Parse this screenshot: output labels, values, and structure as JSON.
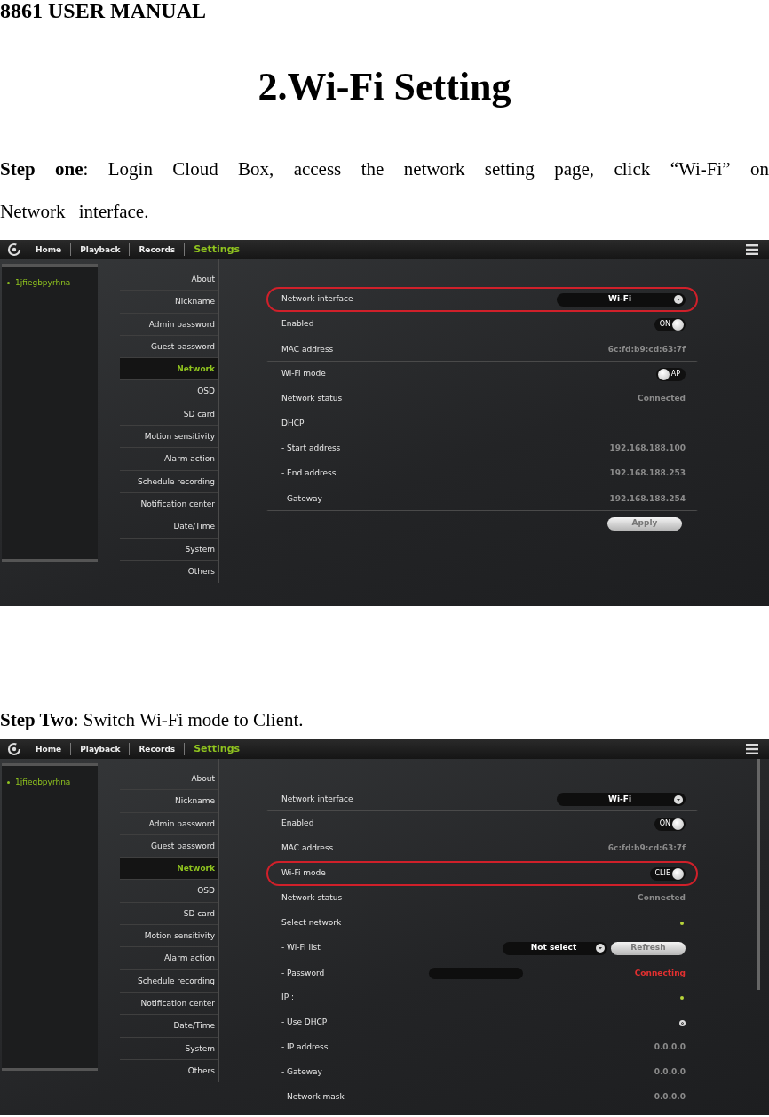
{
  "header": "8861 USER MANUAL",
  "title": "2.Wi-Fi Setting",
  "sections": [
    {
      "instruction": "**Step one**: Login Cloud Box, access the network setting page, click “Wi-Fi” on Network interface.",
      "screenshot": {
        "nav_tabs": [
          {
            "label": "Home",
            "selected": false
          },
          {
            "label": "Playback",
            "selected": false
          },
          {
            "label": "Records",
            "selected": false
          },
          {
            "label": "Settings",
            "selected": true
          }
        ],
        "devices": [
          "1jfiegbpyrhna"
        ],
        "menu": [
          {
            "label": "About",
            "selected": false
          },
          {
            "label": "Nickname",
            "selected": false
          },
          {
            "label": "Admin password",
            "selected": false
          },
          {
            "label": "Guest password",
            "selected": false
          },
          {
            "label": "Network",
            "selected": true
          },
          {
            "label": "OSD",
            "selected": false
          },
          {
            "label": "SD card",
            "selected": false
          },
          {
            "label": "Motion sensitivity",
            "selected": false
          },
          {
            "label": "Alarm action",
            "selected": false
          },
          {
            "label": "Schedule recording",
            "selected": false
          },
          {
            "label": "Notification center",
            "selected": false
          },
          {
            "label": "Date/Time",
            "selected": false
          },
          {
            "label": "System",
            "selected": false
          },
          {
            "label": "Others",
            "selected": false
          }
        ],
        "rows": [
          {
            "kind": "dropdown",
            "label": "Network interface",
            "value": "Wi-Fi",
            "circled": true,
            "divider": true
          },
          {
            "kind": "toggle",
            "label": "Enabled",
            "value": "ON",
            "on": true,
            "circled": false,
            "divider": false
          },
          {
            "kind": "text",
            "label": "MAC address",
            "value": "6c:fd:b9:cd:63:7f",
            "circled": false,
            "divider": true
          },
          {
            "kind": "toggle",
            "label": "Wi-Fi mode",
            "value": "AP",
            "on": false,
            "circled": false,
            "divider": false
          },
          {
            "kind": "text",
            "label": "Network status",
            "value": "Connected",
            "circled": false,
            "divider": false
          },
          {
            "kind": "heading",
            "label": "DHCP",
            "circled": false,
            "divider": false
          },
          {
            "kind": "text",
            "label": "- Start address",
            "value": "192.168.188.100",
            "circled": false,
            "divider": false
          },
          {
            "kind": "text",
            "label": "- End address",
            "value": "192.168.188.253",
            "circled": false,
            "divider": false
          },
          {
            "kind": "text",
            "label": "- Gateway",
            "value": "192.168.188.254",
            "circled": false,
            "divider": true
          },
          {
            "kind": "button",
            "label": "Apply",
            "circled": false,
            "divider": false
          }
        ],
        "scrollbar": false
      }
    },
    {
      "instruction": "**Step Two**: Switch Wi-Fi mode to Client.",
      "screenshot": {
        "nav_tabs": [
          {
            "label": "Home",
            "selected": false
          },
          {
            "label": "Playback",
            "selected": false
          },
          {
            "label": "Records",
            "selected": false
          },
          {
            "label": "Settings",
            "selected": true
          }
        ],
        "devices": [
          "1jfiegbpyrhna"
        ],
        "menu": [
          {
            "label": "About",
            "selected": false
          },
          {
            "label": "Nickname",
            "selected": false
          },
          {
            "label": "Admin password",
            "selected": false
          },
          {
            "label": "Guest password",
            "selected": false
          },
          {
            "label": "Network",
            "selected": true
          },
          {
            "label": "OSD",
            "selected": false
          },
          {
            "label": "SD card",
            "selected": false
          },
          {
            "label": "Motion sensitivity",
            "selected": false
          },
          {
            "label": "Alarm action",
            "selected": false
          },
          {
            "label": "Schedule recording",
            "selected": false
          },
          {
            "label": "Notification center",
            "selected": false
          },
          {
            "label": "Date/Time",
            "selected": false
          },
          {
            "label": "System",
            "selected": false
          },
          {
            "label": "Others",
            "selected": false
          }
        ],
        "rows": [
          {
            "kind": "dropdown",
            "label": "Network interface",
            "value": "Wi-Fi",
            "circled": false,
            "divider": true
          },
          {
            "kind": "toggle",
            "label": "Enabled",
            "value": "ON",
            "on": true,
            "circled": false,
            "divider": false
          },
          {
            "kind": "text",
            "label": "MAC address",
            "value": "6c:fd:b9:cd:63:7f",
            "circled": false,
            "divider": false
          },
          {
            "kind": "toggle",
            "label": "Wi-Fi mode",
            "value": "CLIE",
            "on": true,
            "circled": true,
            "divider": false
          },
          {
            "kind": "text",
            "label": "Network status",
            "value": "Connected",
            "circled": false,
            "divider": false
          },
          {
            "kind": "indicator",
            "label": "Select network :",
            "circled": false,
            "divider": false
          },
          {
            "kind": "select_refresh",
            "label": "- Wi-Fi list",
            "value": "Not select",
            "button": "Refresh",
            "circled": false,
            "divider": false
          },
          {
            "kind": "password",
            "label": "- Password",
            "status": "Connecting",
            "circled": false,
            "divider": true
          },
          {
            "kind": "indicator",
            "label": "IP :",
            "circled": false,
            "divider": false
          },
          {
            "kind": "radio",
            "label": "- Use DHCP",
            "checked": true,
            "circled": false,
            "divider": false
          },
          {
            "kind": "text",
            "label": "- IP address",
            "value": "0.0.0.0",
            "circled": false,
            "divider": false
          },
          {
            "kind": "text",
            "label": "- Gateway",
            "value": "0.0.0.0",
            "circled": false,
            "divider": false
          },
          {
            "kind": "text",
            "label": "- Network mask",
            "value": "0.0.0.0",
            "circled": false,
            "divider": false
          }
        ],
        "scrollbar": true
      }
    }
  ]
}
